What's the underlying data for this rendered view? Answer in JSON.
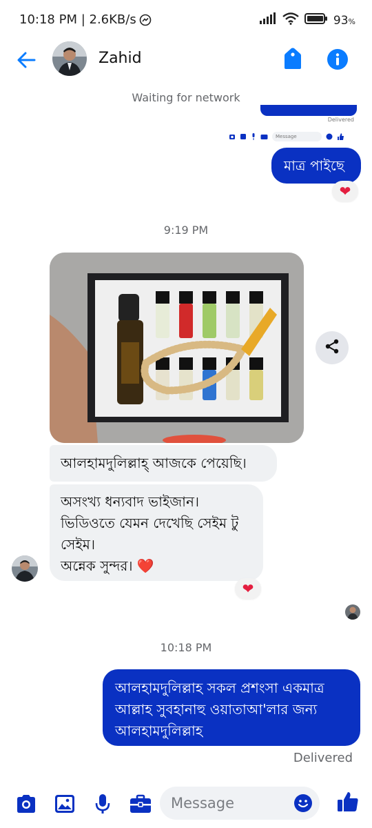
{
  "status_bar": {
    "time_speed": "10:18 PM | 2.6KB/s",
    "battery": "93",
    "battery_unit": "%",
    "signal_icon": "signal-icon",
    "wifi_icon": "wifi-icon",
    "battery_icon": "battery-icon",
    "messenger_icon": "messenger-notification-icon"
  },
  "header": {
    "contact_name": "Zahid",
    "back_icon": "back-arrow-icon",
    "tag_icon": "tag-icon",
    "info_icon": "info-icon"
  },
  "network_status": "Waiting for network",
  "screenshot_thumb": {
    "delivered_label": "Delivered",
    "placeholder": "Message"
  },
  "messages": {
    "m1_text": "মাত্র পাইছে",
    "m1_reaction": "❤",
    "time_1": "9:19 PM",
    "m2_text": "আলহামদুলিল্লাহ্ আজকে পেয়েছি।",
    "m3_line1": "অসংখ্য ধন্যবাদ ভাইজান।",
    "m3_line2": "ভিডিওতে যেমন দেখেছি সেইম টু",
    "m3_line3": "সেইম।",
    "m3_line4": "অন্নেক সুন্দর। ❤️",
    "m3_reaction": "❤",
    "time_2": "10:18 PM",
    "m4_line1": "আলহামদুলিল্লাহ সকল প্রশংসা একমাত্র",
    "m4_line2": "আল্লাহ সুবহানাহু ওয়াতাআ'লার জন্য",
    "m4_line3": "আলহামদুলিল্লাহ",
    "delivered": "Delivered"
  },
  "composer": {
    "placeholder": "Message",
    "camera_icon": "camera-icon",
    "gallery_icon": "gallery-icon",
    "mic_icon": "microphone-icon",
    "briefcase_icon": "briefcase-icon",
    "emoji_icon": "emoji-icon",
    "like_icon": "thumbs-up-icon"
  },
  "colors": {
    "accent": "#0a7cff",
    "outgoing_bubble": "#0a31c2",
    "incoming_bubble": "#eff1f3",
    "heart": "#e41e3f"
  }
}
